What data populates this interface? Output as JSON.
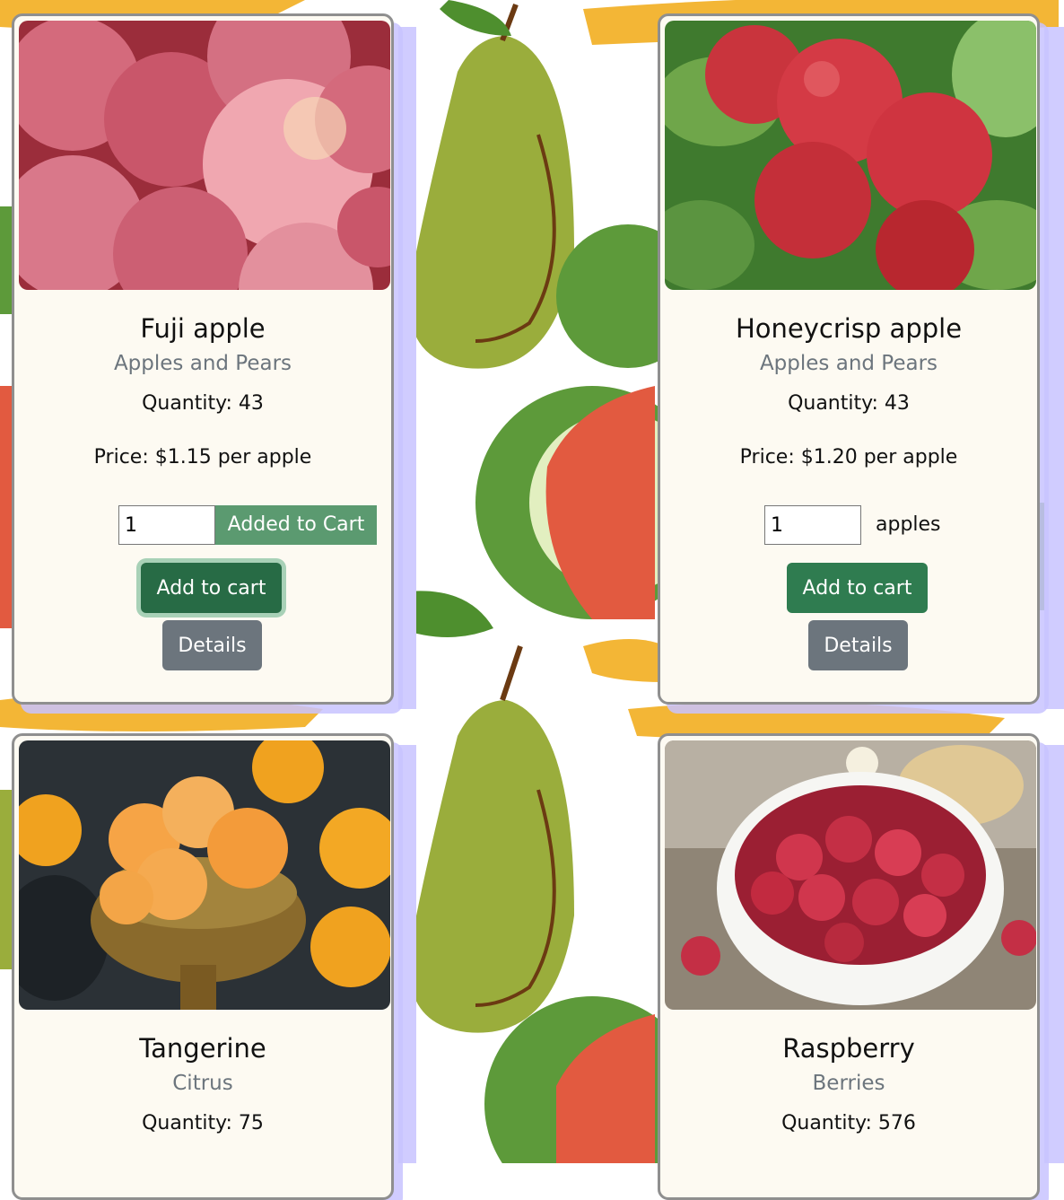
{
  "products": [
    {
      "name": "Fuji apple",
      "category": "Apples and Pears",
      "quantity": "Quantity: 43",
      "price": "Price: $1.15 per apple",
      "input_value": "1",
      "added_label": "Added to Cart",
      "add_button": "Add to cart",
      "details_button": "Details"
    },
    {
      "name": "Honeycrisp apple",
      "category": "Apples and Pears",
      "quantity": "Quantity: 43",
      "price": "Price: $1.20 per apple",
      "input_value": "1",
      "unit_label": "apples",
      "add_button": "Add to cart",
      "details_button": "Details"
    },
    {
      "name": "Tangerine",
      "category": "Citrus",
      "quantity": "Quantity: 75"
    },
    {
      "name": "Raspberry",
      "category": "Berries",
      "quantity": "Quantity: 576"
    }
  ],
  "colors": {
    "card_background": "#fdfaf2",
    "add_button": "#2f7c50",
    "details_button": "#6c757d",
    "added_label": "#5b9a70",
    "category_text": "#6c757d"
  }
}
